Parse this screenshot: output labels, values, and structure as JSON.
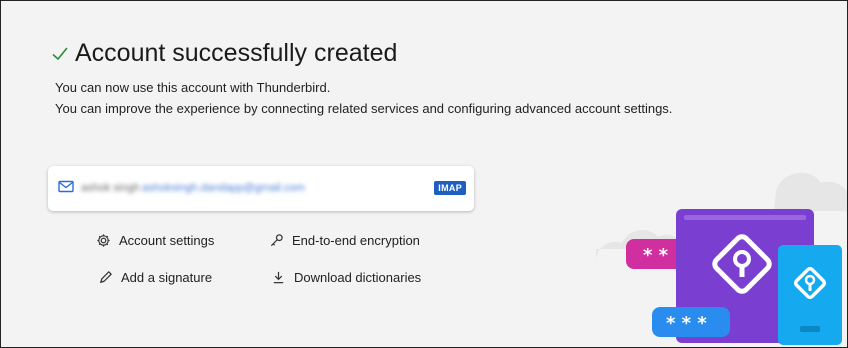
{
  "header": {
    "title": "Account successfully created",
    "check_icon": "check-icon"
  },
  "info": {
    "line1": "You can now use this account with Thunderbird.",
    "line2": "You can improve the experience by connecting related services and configuring advanced account settings."
  },
  "account_card": {
    "icon": "mail-icon",
    "name": "ashok singh",
    "email": "ashoksingh.dandapp@gmail.com",
    "protocol_badge": "IMAP"
  },
  "links": {
    "account_settings": "Account settings",
    "end_to_end": "End-to-end encryption",
    "add_signature": "Add a signature",
    "download_dictionaries": "Download dictionaries"
  },
  "illustration": {
    "password_mask_1": "* *",
    "password_mask_2": "* * *"
  },
  "colors": {
    "accent_blue": "#1f5fbf",
    "purple": "#7a3fd1",
    "pink": "#d02fa0",
    "cyan": "#15a9f0",
    "background": "#f3f3f3"
  }
}
